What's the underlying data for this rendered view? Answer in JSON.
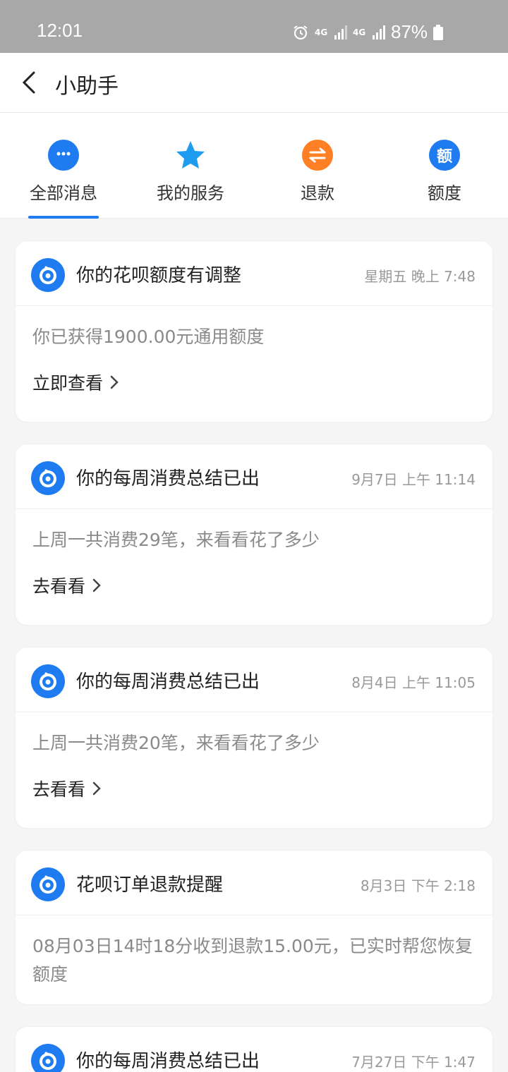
{
  "status": {
    "time": "12:01",
    "net1": "4G",
    "net2": "4G",
    "battery": "87%"
  },
  "header": {
    "title": "小助手"
  },
  "tabs": [
    {
      "label": "全部消息",
      "icon": "chat-bubble-icon",
      "color": "#1e7cf0"
    },
    {
      "label": "我的服务",
      "icon": "star-icon",
      "color": "#1e9cf0"
    },
    {
      "label": "退款",
      "icon": "refund-icon",
      "color": "#ff7f24"
    },
    {
      "label": "额度",
      "icon": "quota-icon",
      "glyph": "额",
      "color": "#1e7cf0"
    }
  ],
  "cards": [
    {
      "title": "你的花呗额度有调整",
      "time": "星期五 晚上 7:48",
      "text": "你已获得1900.00元通用额度",
      "link": "立即查看"
    },
    {
      "title": "你的每周消费总结已出",
      "time": "9月7日 上午 11:14",
      "text": "上周一共消费29笔，来看看花了多少",
      "link": "去看看"
    },
    {
      "title": "你的每周消费总结已出",
      "time": "8月4日 上午 11:05",
      "text": "上周一共消费20笔，来看看花了多少",
      "link": "去看看"
    },
    {
      "title": "花呗订单退款提醒",
      "time": "8月3日 下午 2:18",
      "text": "08月03日14时18分收到退款15.00元，已实时帮您恢复额度"
    },
    {
      "title": "你的每周消费总结已出",
      "time": "7月27日 下午 1:47"
    }
  ]
}
